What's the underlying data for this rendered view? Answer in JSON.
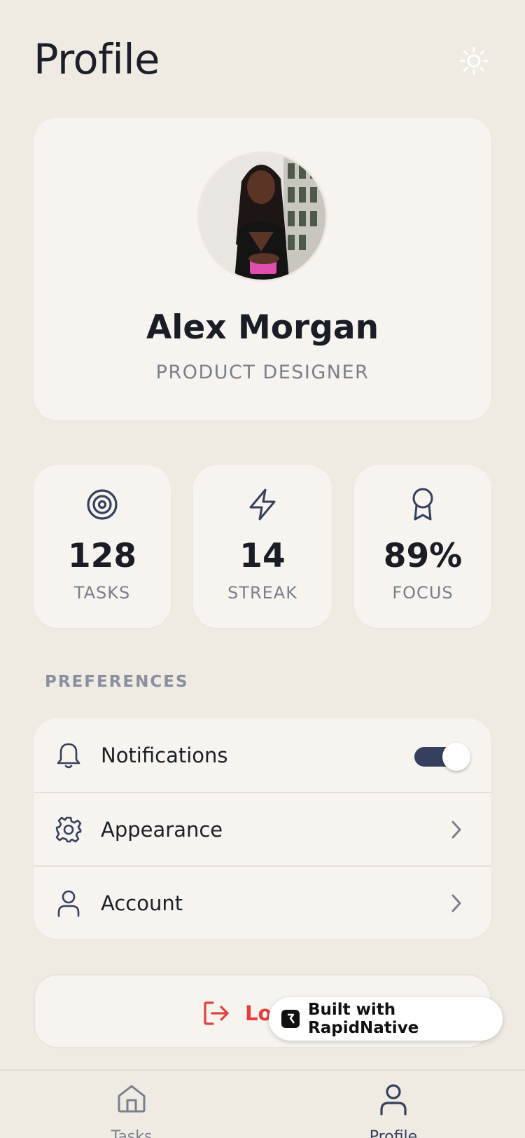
{
  "header": {
    "title": "Profile",
    "theme_icon": "sun-icon"
  },
  "profile": {
    "name": "Alex Morgan",
    "role": "PRODUCT DESIGNER"
  },
  "stats": [
    {
      "icon": "target-icon",
      "value": "128",
      "label": "TASKS"
    },
    {
      "icon": "lightning-icon",
      "value": "14",
      "label": "STREAK"
    },
    {
      "icon": "award-icon",
      "value": "89%",
      "label": "FOCUS"
    }
  ],
  "preferences": {
    "title": "PREFERENCES",
    "items": [
      {
        "icon": "bell-icon",
        "label": "Notifications",
        "control": "toggle",
        "enabled": true
      },
      {
        "icon": "gear-icon",
        "label": "Appearance",
        "control": "chevron"
      },
      {
        "icon": "user-icon",
        "label": "Account",
        "control": "chevron"
      }
    ]
  },
  "logout": {
    "label": "Lo",
    "icon": "logout-icon"
  },
  "badge": {
    "label": "Built with RapidNative"
  },
  "tabbar": {
    "items": [
      {
        "icon": "home-icon",
        "label": "Tasks"
      },
      {
        "icon": "user-icon",
        "label": "Profile",
        "active": true
      }
    ]
  },
  "colors": {
    "background": "#efebe3",
    "card": "#f7f3ee",
    "text_primary": "#1c1f2a",
    "text_muted": "#7a7f8e",
    "accent_navy": "#34405e",
    "danger": "#e2403f"
  }
}
